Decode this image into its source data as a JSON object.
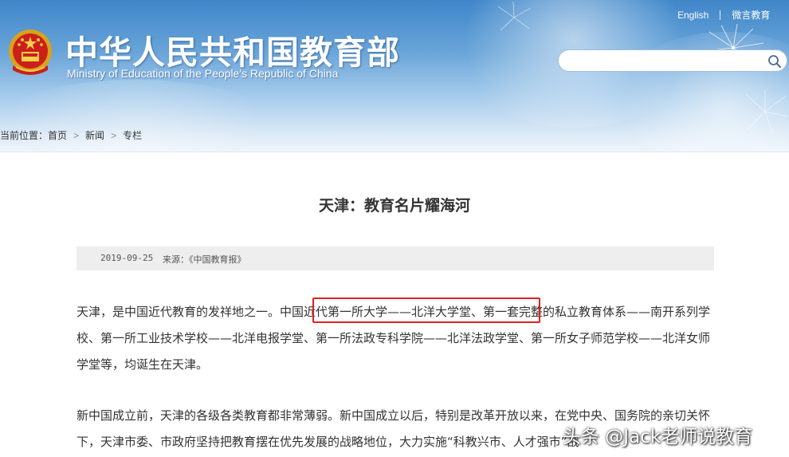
{
  "header": {
    "site_title_cn": "中华人民共和国教育部",
    "site_title_en": "Ministry of Education of the People's Republic of China",
    "top_links": {
      "english": "English",
      "weibo": "微言教育"
    },
    "search": {
      "placeholder": ""
    }
  },
  "breadcrumb": {
    "prefix": "当前位置：",
    "items": [
      "首页",
      "新闻",
      "专栏"
    ]
  },
  "article": {
    "title": "天津：教育名片耀海河",
    "date": "2019-09-25",
    "source": "来源：《中国教育报》",
    "paragraphs": [
      "天津，是中国近代教育的发祥地之一。中国近代第一所大学——北洋大学堂、第一套完整的私立教育体系——南开系列学校、第一所工业技术学校——北洋电报学堂、第一所法政专科学院——北洋法政学堂、第一所女子师范学校——北洋女师学堂等，均诞生在天津。",
      "新中国成立前，天津的各级各类教育都非常薄弱。新中国成立以后，特别是改革开放以来，在党中央、国务院的亲切关怀下，天津市委、市政府坚持把教育摆在优先发展的战略地位，大力实施“科教兴市、人才强市”战"
    ]
  },
  "watermark": "头条 @Jack老师说教育",
  "colors": {
    "highlight_border": "#e02020",
    "banner_blue": "#3f86c9"
  }
}
